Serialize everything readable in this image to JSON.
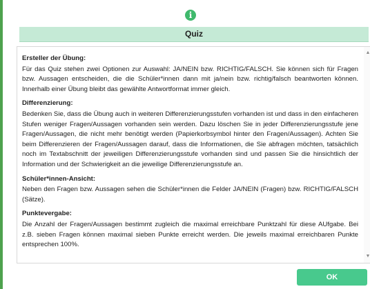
{
  "header": {
    "icon": "info-circle-icon",
    "title": "Quiz"
  },
  "sections": [
    {
      "heading": "Ersteller der Übung:",
      "text": "Für das Quiz stehen zwei Optionen zur Auswahl: JA/NEIN bzw. RICHTIG/FALSCH. Sie können sich für Fragen bzw. Aussagen entscheiden, die die Schüler*innen dann mit ja/nein bzw. richtig/falsch beantworten können. Innerhalb einer Übung bleibt das gewählte Antwortformat immer gleich."
    },
    {
      "heading": "Differenzierung:",
      "text": "Bedenken Sie, dass die Übung auch in weiteren Differenzierungsstufen vorhanden ist und dass in den einfacheren Stufen weniger Fragen/Aussagen vorhanden sein werden. Dazu löschen Sie in jeder Differenzierungsstufe jene Fragen/Aussagen, die nicht mehr benötigt werden (Papierkorbsymbol hinter den Fragen/Aussagen). Achten Sie beim Differenzieren der Fragen/Aussagen darauf, dass die Informationen, die Sie abfragen möchten, tatsächlich noch im Textabschnitt der jeweiligen Differenzierungsstufe vorhanden sind und passen Sie die hinsichtlich der Information und der Schwierigkeit an die jeweilige Differenzierungsstufe an."
    },
    {
      "heading": "Schüler*innen-Ansicht:",
      "text": "Neben den Fragen bzw. Aussagen sehen die Schüler*innen die Felder JA/NEIN (Fragen) bzw. RICHTIG/FALSCH (Sätze)."
    },
    {
      "heading": "Punktevergabe:",
      "text": "Die Anzahl der Fragen/Aussagen bestimmt zugleich die maximal erreichbare Punktzahl für diese AUfgabe. Bei z.B. sieben Fragen können maximal sieben Punkte erreicht werden. Die jeweils maximal erreichbaren Punkte entsprechen 100%."
    }
  ],
  "footer": {
    "ok_label": "OK"
  }
}
